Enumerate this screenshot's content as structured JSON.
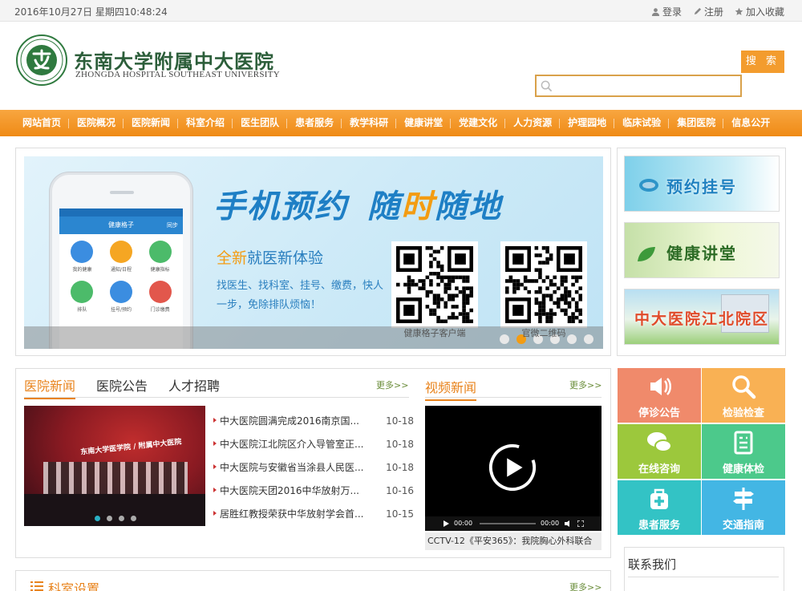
{
  "topbar": {
    "datetime": "2016年10月27日 星期四10:48:24",
    "login": "登录",
    "register": "注册",
    "favorite": "加入收藏"
  },
  "header": {
    "name_cn": "东南大学附属中大医院",
    "name_en": "ZHONGDA HOSPITAL SOUTHEAST UNIVERSITY",
    "search_label": "搜 索",
    "search_placeholder": ""
  },
  "nav": [
    "网站首页",
    "医院概况",
    "医院新闻",
    "科室介绍",
    "医生团队",
    "患者服务",
    "教学科研",
    "健康讲堂",
    "党建文化",
    "人力资源",
    "护理园地",
    "临床试验",
    "集团医院",
    "信息公开"
  ],
  "banner": {
    "slogan_a": "手机预约",
    "slogan_b1": "随",
    "slogan_b2": "时",
    "slogan_b3": "随地",
    "sub_hl": "全新",
    "sub_rest": "就医新体验",
    "desc": "找医生、找科室、挂号、缴费，快人一步，免除排队烦恼！",
    "phone_app": "健康格子",
    "phone_sync": "同步",
    "phone_apps": [
      "我的健康",
      "通知/日程",
      "健康指标",
      "排队",
      "挂号/预约",
      "门诊缴费"
    ],
    "qr1_label": "健康格子客户端",
    "qr2_label": "官微二维码",
    "slide_count": 6,
    "active_slide": 2
  },
  "ads": [
    "预约挂号",
    "健康讲堂",
    "中大医院江北院区"
  ],
  "news": {
    "tabs": [
      "医院新闻",
      "医院公告",
      "人才招聘"
    ],
    "more": "更多>>",
    "items": [
      {
        "title": "中大医院圆满完成2016南京国...",
        "date": "10-18"
      },
      {
        "title": "中大医院江北院区介入导管室正...",
        "date": "10-18"
      },
      {
        "title": "中大医院与安徽省当涂县人民医...",
        "date": "10-18"
      },
      {
        "title": "中大医院天团2016中华放射万...",
        "date": "10-16"
      },
      {
        "title": "居胜红教授荣获中华放射学会首...",
        "date": "10-15"
      }
    ],
    "img_caption": "东南大学医学院 / 附属中大医院"
  },
  "video": {
    "title": "视频新闻",
    "more": "更多>>",
    "time_a": "00:00",
    "time_b": "00:00",
    "caption": "CCTV-12《平安365》：我院胸心外科联合"
  },
  "services": [
    {
      "label": "停诊公告",
      "color": "#f08a6b"
    },
    {
      "label": "检验检查",
      "color": "#f9b154"
    },
    {
      "label": "在线咨询",
      "color": "#9cc83c"
    },
    {
      "label": "健康体检",
      "color": "#4cc98b"
    },
    {
      "label": "患者服务",
      "color": "#33c3c5"
    },
    {
      "label": "交通指南",
      "color": "#43b6e4"
    }
  ],
  "contact": {
    "title": "联系我们"
  },
  "dept": {
    "title": "科室设置",
    "more": "更多>>"
  }
}
